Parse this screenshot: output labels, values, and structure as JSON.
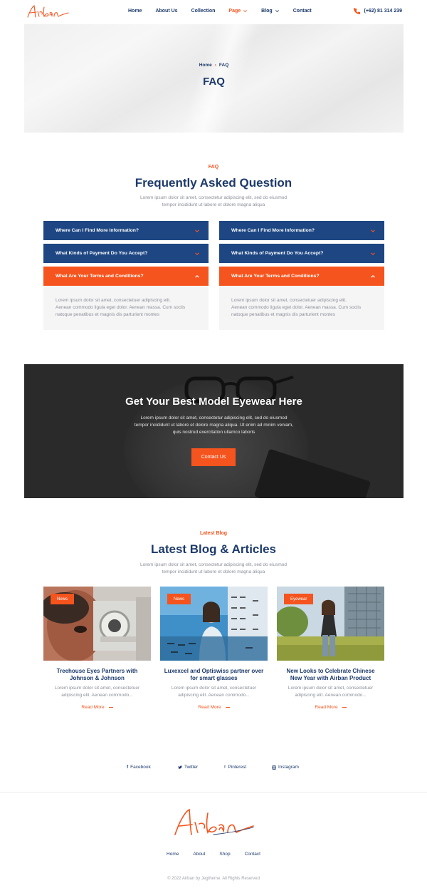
{
  "header": {
    "logo_text": "Airban",
    "nav": [
      {
        "label": "Home"
      },
      {
        "label": "About Us"
      },
      {
        "label": "Collection"
      },
      {
        "label": "Page"
      },
      {
        "label": "Blog"
      },
      {
        "label": "Contact"
      }
    ],
    "phone": "(+62) 81 314 239"
  },
  "hero": {
    "breadcrumb_home": "Home",
    "breadcrumb_current": "FAQ",
    "title": "FAQ"
  },
  "faq": {
    "eyebrow": "FAQ",
    "title": "Frequently Asked Question",
    "subtitle_line1": "Lorem ipsum dolor sit amet, consectetur adipiscing elit, sed do eiusmod",
    "subtitle_line2": "tempor incididunt ut labore et dolore magna aliqua",
    "left": {
      "q1": "Where Can I Find More Information?",
      "q2": "What Kinds of Payment Do You Accept?",
      "q3": "What Are Your Terms and Conditions?",
      "answer_line1": "Lorem ipsum dolor sit amet, consectetuer adipiscing elit.",
      "answer_line2": "Aenean commodo ligula eget dolor. Aenean massa. Cum sociis",
      "answer_line3": "natoque penatibus et magnis dis parturient montes"
    },
    "right": {
      "q1": "Where Can I Find More Information?",
      "q2": "What Kinds of Payment Do You Accept?",
      "q3": "What Are Your Terms and Conditions?",
      "answer_line1": "Lorem ipsum dolor sit amet, consectetuer adipiscing elit.",
      "answer_line2": "Aenean commodo ligula eget dolor. Aenean massa. Cum sociis",
      "answer_line3": "natoque penatibus et magnis dis parturient montes"
    }
  },
  "cta": {
    "title": "Get Your Best Model Eyewear Here",
    "text_line1": "Lorem ipsum dolor sit amet, consectetur adipiscing elit, sed do eiusmod",
    "text_line2": "tempor incididunt ut labore et dolore magna aliqua. Ut enim ad minim veniam,",
    "text_line3": "quis nostrud exercitation ullamco laboris",
    "button": "Contact Us"
  },
  "blog": {
    "eyebrow": "Latest Blog",
    "title": "Latest Blog & Articles",
    "subtitle_line1": "Lorem ipsum dolor sit amet, consectetur adipiscing elit, sed do eiusmod",
    "subtitle_line2": "tempor incididunt ut labore et dolore magna aliqua",
    "posts": [
      {
        "badge": "News",
        "title_line1": "Treehouse Eyes Partners with",
        "title_line2": "Johnson & Johnson",
        "excerpt_line1": "Lorem ipsum dolor sit amet, consectetuer",
        "excerpt_line2": "adipiscing elit. Aenean commodo...",
        "read_more": "Read More"
      },
      {
        "badge": "News",
        "title_line1": "Luxexcel and Optiswiss partner over",
        "title_line2": "for smart glasses",
        "excerpt_line1": "Lorem ipsum dolor sit amet, consectetuer",
        "excerpt_line2": "adipiscing elit. Aenean commodo...",
        "read_more": "Read More"
      },
      {
        "badge": "Eyewear",
        "title_line1": "New Looks to Celebrate Chinese",
        "title_line2": "New Year with Airban Product",
        "excerpt_line1": "Lorem ipsum dolor sit amet, consectetuer",
        "excerpt_line2": "adipiscing elit. Aenean commodo...",
        "read_more": "Read More"
      }
    ]
  },
  "social": {
    "facebook": "Facebook",
    "twitter": "Twitter",
    "pinterest": "Pinterest",
    "instagram": "Instagram"
  },
  "footer": {
    "logo_text": "Airban",
    "nav": [
      "Home",
      "About",
      "Shop",
      "Contact"
    ],
    "copyright": "© 2022 Airban by Jegtheme. All Rights Reserved"
  },
  "colors": {
    "navy": "#1d3a6b",
    "accent": "#f5541e",
    "faq_blue": "#1d4683"
  }
}
